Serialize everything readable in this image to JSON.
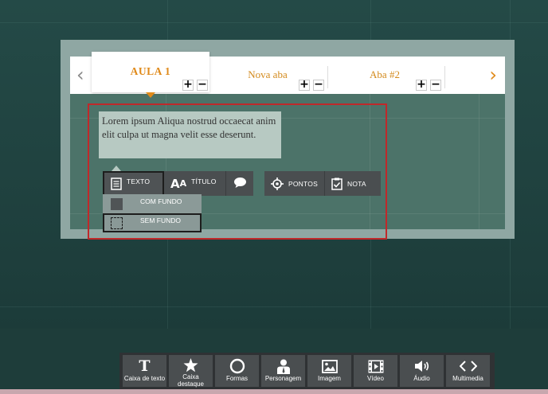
{
  "tabs": {
    "active_label": "AULA 1",
    "items": [
      {
        "label": "Nova aba"
      },
      {
        "label": "Aba #2"
      }
    ],
    "add_symbol": "+",
    "remove_symbol": "−"
  },
  "textbox": {
    "text": "Lorem ipsum Aliqua nostrud occaecat anim elit culpa ut magna velit esse deserunt."
  },
  "toolbar": {
    "texto_label": "TEXTO",
    "titulo_label": "TÍTULO",
    "pontos_label": "PONTOS",
    "nota_label": "NOTA"
  },
  "dropdown": {
    "com_fundo_label": "COM FUNDO",
    "sem_fundo_label": "SEM FUNDO"
  },
  "bottom_toolbar": {
    "items": [
      {
        "label": "Caixa de texto",
        "icon": "text-icon"
      },
      {
        "label": "Caixa destaque",
        "icon": "star-icon"
      },
      {
        "label": "Formas",
        "icon": "circle-icon"
      },
      {
        "label": "Personagem",
        "icon": "person-icon"
      },
      {
        "label": "Imagem",
        "icon": "image-icon"
      },
      {
        "label": "Vídeo",
        "icon": "film-icon"
      },
      {
        "label": "Áudio",
        "icon": "speaker-icon"
      },
      {
        "label": "Multimedia",
        "icon": "code-icon"
      }
    ]
  },
  "colors": {
    "accent": "#e08a1a",
    "selection": "#c0282a",
    "background": "#1f403d"
  }
}
